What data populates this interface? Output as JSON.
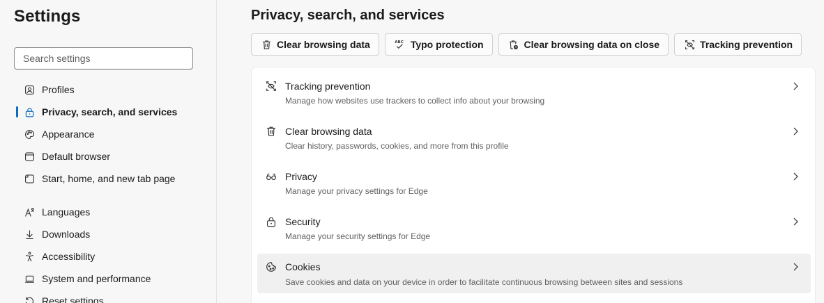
{
  "sidebar": {
    "title": "Settings",
    "search_placeholder": "Search settings",
    "items": [
      {
        "label": "Profiles",
        "icon": "profile-icon"
      },
      {
        "label": "Privacy, search, and services",
        "icon": "lock-icon",
        "active": true
      },
      {
        "label": "Appearance",
        "icon": "palette-icon"
      },
      {
        "label": "Default browser",
        "icon": "browser-window-icon"
      },
      {
        "label": "Start, home, and new tab page",
        "icon": "home-window-icon"
      },
      {
        "label": "Languages",
        "icon": "language-icon"
      },
      {
        "label": "Downloads",
        "icon": "download-icon"
      },
      {
        "label": "Accessibility",
        "icon": "accessibility-icon"
      },
      {
        "label": "System and performance",
        "icon": "laptop-icon"
      },
      {
        "label": "Reset settings",
        "icon": "reset-icon"
      }
    ]
  },
  "main": {
    "title": "Privacy, search, and services",
    "quick_buttons": [
      {
        "label": "Clear browsing data",
        "icon": "trash-icon"
      },
      {
        "label": "Typo protection",
        "icon": "spellcheck-icon"
      },
      {
        "label": "Clear browsing data on close",
        "icon": "trash-clock-icon"
      },
      {
        "label": "Tracking prevention",
        "icon": "tracking-prevention-icon"
      }
    ],
    "rows": [
      {
        "title": "Tracking prevention",
        "desc": "Manage how websites use trackers to collect info about your browsing",
        "icon": "tracking-prevention-icon"
      },
      {
        "title": "Clear browsing data",
        "desc": "Clear history, passwords, cookies, and more from this profile",
        "icon": "trash-icon"
      },
      {
        "title": "Privacy",
        "desc": "Manage your privacy settings for Edge",
        "icon": "glasses-icon"
      },
      {
        "title": "Security",
        "desc": "Manage your security settings for Edge",
        "icon": "lock-icon"
      },
      {
        "title": "Cookies",
        "desc": "Save cookies and data on your device in order to facilitate continuous browsing between sites and sessions",
        "icon": "cookie-icon",
        "highlighted": true
      }
    ]
  },
  "colors": {
    "accent": "#0f6cbd",
    "background": "#f7f7f7",
    "card": "#ffffff",
    "hover_row": "#f0f0f0"
  }
}
